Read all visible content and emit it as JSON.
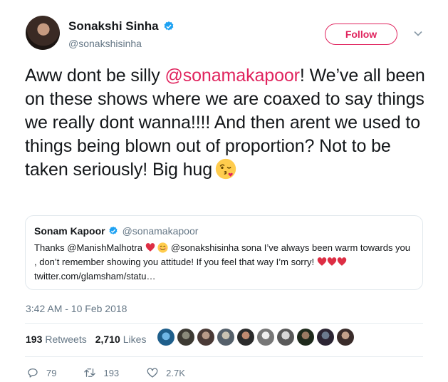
{
  "author": {
    "display_name": "Sonakshi Sinha",
    "handle": "@sonakshisinha"
  },
  "follow_label": "Follow",
  "tweet": {
    "text_before": "Aww dont be silly ",
    "mention": "@sonamakapoor",
    "text_after": "! We’ve all been on these shows where we are coaxed to say things we really dont wanna!!!! And then arent we used to things being blown out of proportion? Not to be taken seriously! Big hug"
  },
  "quoted": {
    "display_name": "Sonam Kapoor",
    "handle": "@sonamakapoor",
    "text_part1": "Thanks @ManishMalhotra",
    "text_part2": "@sonakshisinha sona I’ve always been warm towards you , don’t remember showing you attitude! If you feel that way I’m sorry!",
    "link": "twitter.com/glamsham/statu…"
  },
  "timestamp": "3:42 AM - 10 Feb 2018",
  "stats": {
    "retweets_count": "193",
    "retweets_label": "Retweets",
    "likes_count": "2,710",
    "likes_label": "Likes"
  },
  "actions": {
    "reply_count": "79",
    "retweet_count": "193",
    "like_count": "2.7K"
  },
  "colors": {
    "accent": "#e0245e",
    "verified": "#1da1f2",
    "secondary_text": "#657786"
  },
  "icons": [
    "verified-badge-icon",
    "chevron-down-icon",
    "kissing-face-emoji",
    "red-heart-emoji",
    "smiling-face-emoji",
    "reply-icon",
    "retweet-icon",
    "like-icon"
  ]
}
